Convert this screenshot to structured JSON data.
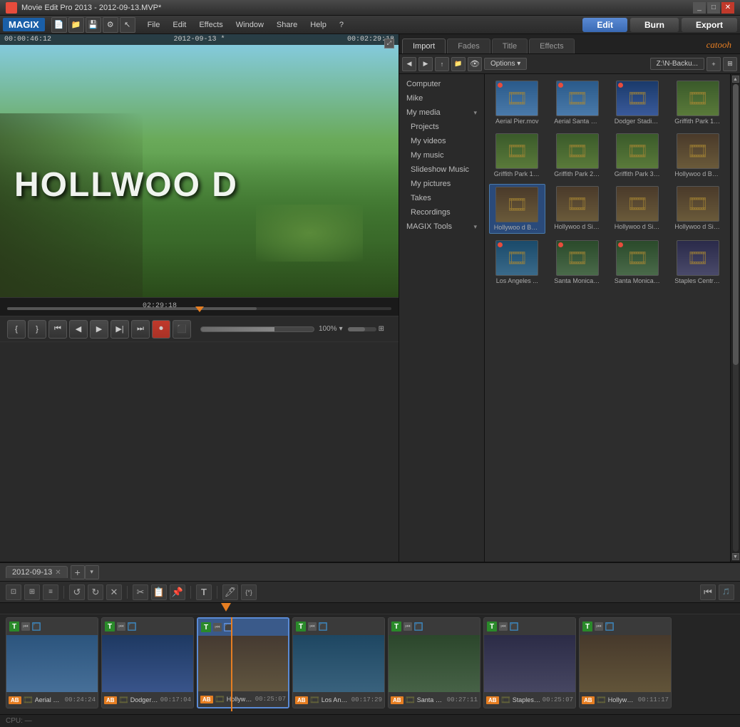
{
  "titleBar": {
    "title": "Movie Edit Pro 2013 - 2012-09-13.MVP*",
    "icon": "M",
    "controls": {
      "minimize": "_",
      "maximize": "□",
      "close": "✕"
    }
  },
  "menuBar": {
    "logo": "MAGIX",
    "menus": [
      "File",
      "Edit",
      "Effects",
      "Window",
      "Share",
      "Help"
    ],
    "helpIcon": "?",
    "topButtons": [
      {
        "id": "edit",
        "label": "Edit",
        "active": true
      },
      {
        "id": "burn",
        "label": "Burn",
        "active": false
      },
      {
        "id": "export",
        "label": "Export",
        "active": false
      }
    ]
  },
  "preview": {
    "timeLeft": "00:00:46:12",
    "timeDate": "2012-09-13 *",
    "timeRight": "00:02:29:18",
    "scrubberTime": "02:29:18",
    "hollywoodText": "HOLLWOO D"
  },
  "transport": {
    "buttons": [
      "⏮",
      "◀",
      "▶",
      "⏭",
      "⏸"
    ],
    "zoom": "100%"
  },
  "browser": {
    "tabs": [
      {
        "id": "import",
        "label": "Import",
        "active": true
      },
      {
        "id": "fades",
        "label": "Fades",
        "active": false
      },
      {
        "id": "title",
        "label": "Title",
        "active": false
      },
      {
        "id": "effects",
        "label": "Effects",
        "active": false
      }
    ],
    "catooh": "catooh",
    "optionsLabel": "Options",
    "pathLabel": "Z:\\N-Backu...",
    "tree": [
      {
        "id": "computer",
        "label": "Computer",
        "level": 0,
        "hasArrow": false
      },
      {
        "id": "mike",
        "label": "Mike",
        "level": 0,
        "hasArrow": false
      },
      {
        "id": "my-media",
        "label": "My media",
        "level": 0,
        "hasArrow": true
      },
      {
        "id": "projects",
        "label": "Projects",
        "level": 1,
        "hasArrow": false
      },
      {
        "id": "my-videos",
        "label": "My videos",
        "level": 1,
        "hasArrow": false
      },
      {
        "id": "my-music",
        "label": "My music",
        "level": 1,
        "hasArrow": false
      },
      {
        "id": "slideshow",
        "label": "Slideshow Music",
        "level": 1,
        "hasArrow": false
      },
      {
        "id": "my-pictures",
        "label": "My pictures",
        "level": 1,
        "hasArrow": false
      },
      {
        "id": "takes",
        "label": "Takes",
        "level": 1,
        "hasArrow": false
      },
      {
        "id": "recordings",
        "label": "Recordings",
        "level": 1,
        "hasArrow": false
      },
      {
        "id": "magix-tools",
        "label": "MAGIX Tools",
        "level": 0,
        "hasArrow": true
      }
    ],
    "mediaItems": [
      {
        "id": "aerial-pier",
        "label": "Aerial Pier.mov",
        "thumbClass": "thumb-aerial",
        "hasDot": true,
        "selected": false
      },
      {
        "id": "aerial-santa",
        "label": "Aerial Santa M...",
        "thumbClass": "thumb-aerial",
        "hasDot": true,
        "selected": false
      },
      {
        "id": "dodger-stadium",
        "label": "Dodger Stadium...",
        "thumbClass": "thumb-dodger",
        "hasDot": true,
        "selected": false
      },
      {
        "id": "griffith-park1",
        "label": "Griffith Park 1(1)...",
        "thumbClass": "thumb-griffith",
        "hasDot": false,
        "selected": false
      },
      {
        "id": "griffith-park1m",
        "label": "Griffith Park 1.m...",
        "thumbClass": "thumb-griffith",
        "hasDot": false,
        "selected": false
      },
      {
        "id": "griffith-park2",
        "label": "Griffith Park 2.m...",
        "thumbClass": "thumb-griffith",
        "hasDot": false,
        "selected": false
      },
      {
        "id": "griffith-park3",
        "label": "Griffith Park 3.m...",
        "thumbClass": "thumb-griffith",
        "hasDot": false,
        "selected": false
      },
      {
        "id": "hollywood-bowl1",
        "label": "Hollywoo d Bowl 1...",
        "thumbClass": "thumb-hollywood",
        "hasDot": false,
        "selected": false
      },
      {
        "id": "hollywood-bowl4",
        "label": "Hollywoo d Bowl 4.mov",
        "thumbClass": "thumb-hollywood",
        "hasDot": false,
        "selected": true
      },
      {
        "id": "hollywood-sign2",
        "label": "Hollywoo d Sign 2...",
        "thumbClass": "thumb-hollywood",
        "hasDot": false,
        "selected": false
      },
      {
        "id": "hollywood-sign3",
        "label": "Hollywoo d Sign 3...",
        "thumbClass": "thumb-hollywood",
        "hasDot": false,
        "selected": false
      },
      {
        "id": "hollywood-sign4",
        "label": "Hollywoo d Sign...",
        "thumbClass": "thumb-hollywood",
        "hasDot": false,
        "selected": false
      },
      {
        "id": "los-angeles",
        "label": "Los Angeles ...",
        "thumbClass": "thumb-la",
        "hasDot": true,
        "selected": false
      },
      {
        "id": "santa-monica1",
        "label": "Santa Monica ...",
        "thumbClass": "thumb-santa",
        "hasDot": true,
        "selected": false
      },
      {
        "id": "santa-monica2",
        "label": "Santa Monica ...",
        "thumbClass": "thumb-santa",
        "hasDot": true,
        "selected": false
      },
      {
        "id": "staples-centre",
        "label": "Staples Centre...",
        "thumbClass": "thumb-staples",
        "hasDot": false,
        "selected": false
      }
    ]
  },
  "timeline": {
    "tabLabel": "2012-09-13",
    "clips": [
      {
        "id": "clip1",
        "name": "Aerial Pier.mov",
        "duration": "00:24:24",
        "selected": false,
        "thumbClass": "thumb-aerial"
      },
      {
        "id": "clip2",
        "name": "Dodger Stad...",
        "duration": "00:17:04",
        "selected": false,
        "thumbClass": "thumb-dodger"
      },
      {
        "id": "clip3",
        "name": "Hollywood Si...",
        "duration": "00:25:07",
        "selected": true,
        "thumbClass": "thumb-hollywood"
      },
      {
        "id": "clip4",
        "name": "Los Angeles ...",
        "duration": "00:17:29",
        "selected": false,
        "thumbClass": "thumb-la"
      },
      {
        "id": "clip5",
        "name": "Santa Monica...",
        "duration": "00:27:11",
        "selected": false,
        "thumbClass": "thumb-santa"
      },
      {
        "id": "clip6",
        "name": "Staples Centr...",
        "duration": "00:25:07",
        "selected": false,
        "thumbClass": "thumb-staples"
      },
      {
        "id": "clip7",
        "name": "Hollywood B...",
        "duration": "00:11:17",
        "selected": false,
        "thumbClass": "thumb-hollywood"
      }
    ]
  },
  "statusBar": {
    "text": "CPU: —"
  }
}
